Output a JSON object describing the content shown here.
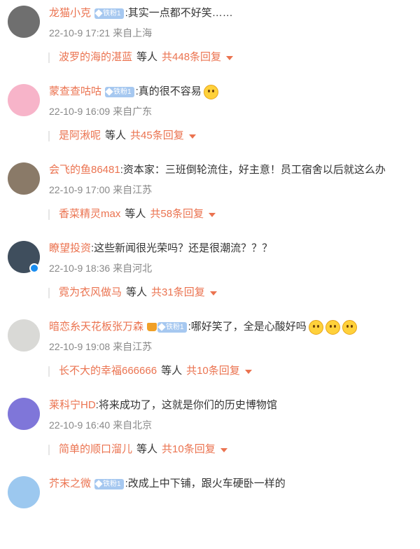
{
  "badges": {
    "iron_fan": "铁粉1"
  },
  "comments": [
    {
      "user": "龙猫小克",
      "has_badge": true,
      "text": ":其实一点都不好笑……",
      "time": "22-10-9 17:21",
      "location": "来自上海",
      "reply_user": "波罗的海的湛蓝",
      "reply_mid": "等人",
      "reply_count": "共448条回复",
      "avatar_color": "#6f6f6f"
    },
    {
      "user": "蒙查查咕咕",
      "has_badge": true,
      "text": ":真的很不容易",
      "emoji": [
        "crying-emoji"
      ],
      "time": "22-10-9 16:09",
      "location": "来自广东",
      "reply_user": "是阿湫呢",
      "reply_mid": "等人",
      "reply_count": "共45条回复",
      "avatar_color": "#f7b4c9"
    },
    {
      "user": "会飞的鱼86481",
      "has_badge": false,
      "text": ":资本家：三班倒轮流住，好主意！员工宿舍以后就这么办",
      "time": "22-10-9 17:00",
      "location": "来自江苏",
      "reply_user": "香菜精灵max",
      "reply_mid": "等人",
      "reply_count": "共58条回复",
      "avatar_color": "#8a7a68"
    },
    {
      "user": "瞭望投资",
      "has_badge": false,
      "verified": true,
      "text": ":这些新闻很光荣吗？还是很潮流？？？",
      "time": "22-10-9 18:36",
      "location": "来自河北",
      "reply_user": "霓为衣风做马",
      "reply_mid": "等人",
      "reply_count": "共31条回复",
      "avatar_color": "#3f4e5d"
    },
    {
      "user": "暗恋糸天花板张万森",
      "has_badge": true,
      "has_crown": true,
      "text": ":哪好笑了，全是心酸好吗",
      "emoji": [
        "smile-emoji",
        "smile-emoji",
        "smile-emoji"
      ],
      "time": "22-10-9 19:08",
      "location": "来自江苏",
      "reply_user": "长不大的幸福666666",
      "reply_mid": "等人",
      "reply_count": "共10条回复",
      "avatar_color": "#d9d9d6"
    },
    {
      "user": "莱科宁HD",
      "has_badge": false,
      "text": ":将来成功了，这就是你们的历史博物馆",
      "time": "22-10-9 16:40",
      "location": "来自北京",
      "reply_user": "简单的顺口溜儿",
      "reply_mid": "等人",
      "reply_count": "共10条回复",
      "avatar_color": "#7f76d9"
    },
    {
      "user": "芥末之微",
      "has_badge": true,
      "text": ":改成上中下铺，跟火车硬卧一样的",
      "avatar_color": "#9cc8ef"
    }
  ]
}
